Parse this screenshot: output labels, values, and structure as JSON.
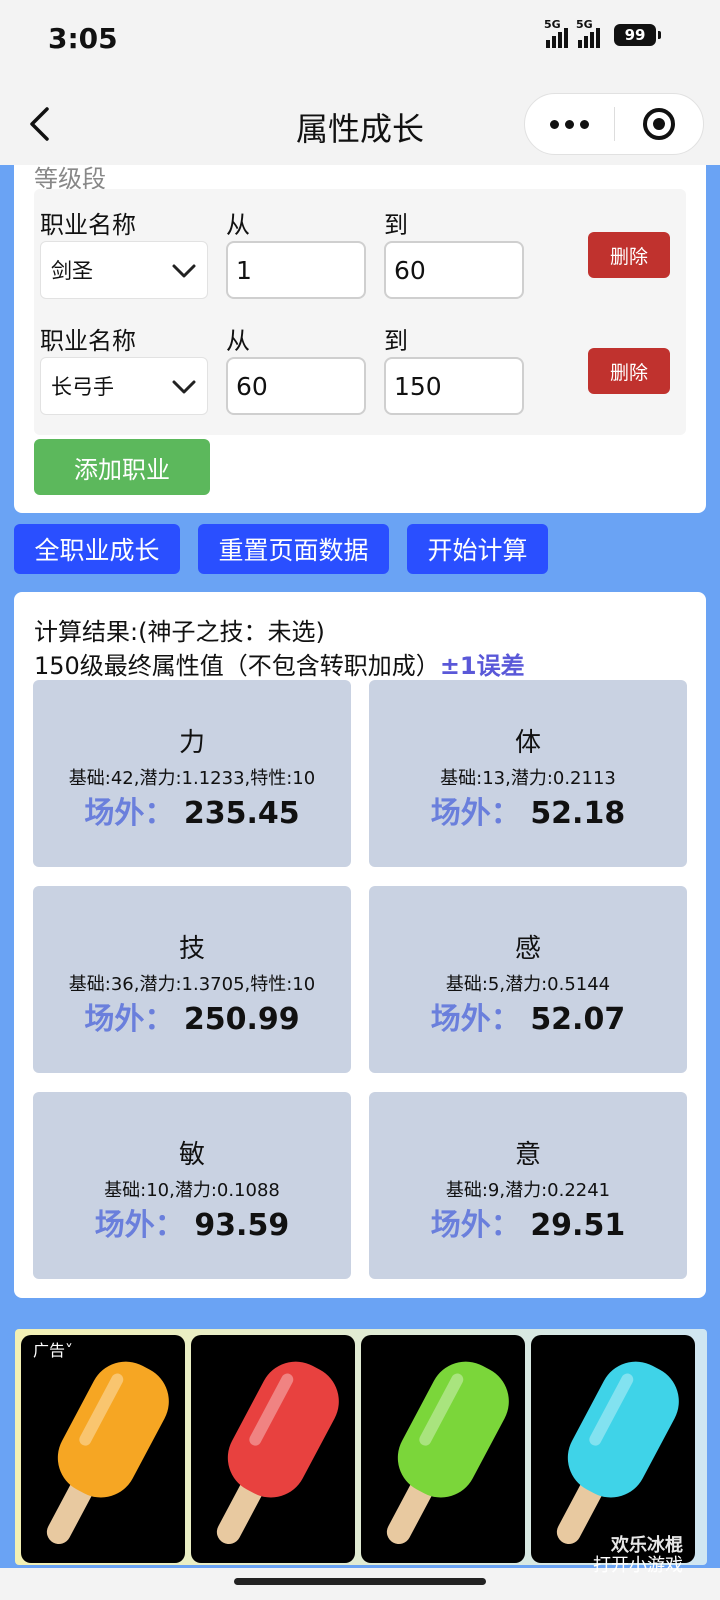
{
  "status_bar": {
    "time": "3:05",
    "signal1": "5G",
    "signal2": "5G",
    "battery": "99"
  },
  "nav": {
    "back_icon": "chevron-left",
    "title": "属性成长",
    "menu_icon": "more-dots",
    "close_icon": "target-circle"
  },
  "level_section": {
    "label": "等级段",
    "jobs": [
      {
        "name_label": "职业名称",
        "name_value": "剑圣",
        "from_label": "从",
        "from_value": "1",
        "to_label": "到",
        "to_value": "60",
        "delete_label": "删除"
      },
      {
        "name_label": "职业名称",
        "name_value": "长弓手",
        "from_label": "从",
        "from_value": "60",
        "to_label": "到",
        "to_value": "150",
        "delete_label": "删除"
      }
    ],
    "add_label": "添加职业"
  },
  "actions": {
    "all_growth": "全职业成长",
    "reset": "重置页面数据",
    "calculate": "开始计算"
  },
  "result": {
    "title": "计算结果:(神子之技：未选)",
    "subtitle": "150级最终属性值（不包含转职加成）",
    "error_note": "±1误差",
    "stats": [
      {
        "name": "力",
        "detail": "基础:42,潜力:1.1233,特性:10",
        "prefix": "场外：",
        "value": "235.45"
      },
      {
        "name": "体",
        "detail": "基础:13,潜力:0.2113",
        "prefix": "场外：",
        "value": "52.18"
      },
      {
        "name": "技",
        "detail": "基础:36,潜力:1.3705,特性:10",
        "prefix": "场外：",
        "value": "250.99"
      },
      {
        "name": "感",
        "detail": "基础:5,潜力:0.5144",
        "prefix": "场外：",
        "value": "52.07"
      },
      {
        "name": "敏",
        "detail": "基础:10,潜力:0.1088",
        "prefix": "场外：",
        "value": "93.59"
      },
      {
        "name": "意",
        "detail": "基础:9,潜力:0.2241",
        "prefix": "场外：",
        "value": "29.51"
      }
    ]
  },
  "ad": {
    "label": "广告˅",
    "brand": "欢乐冰棍",
    "cta": "打开小游戏",
    "colors": [
      "#f6a623",
      "#e8413f",
      "#7bd63a",
      "#3fd3e8"
    ]
  }
}
